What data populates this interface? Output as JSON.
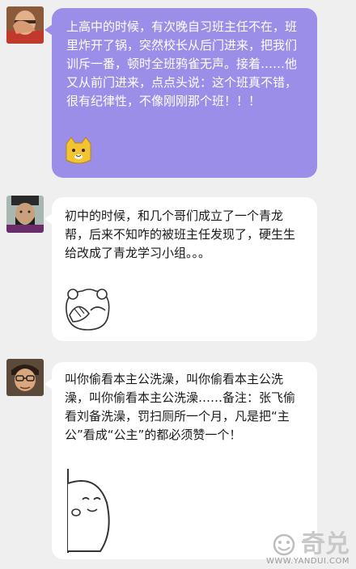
{
  "messages": [
    {
      "text": "上高中的时候，有次晚自习班主任不在，班里炸开了锅，突然校长从后门进来，把我们训斥一番，顿时全班鸦雀无声。接着……他又从前门进来，点点头说：这个班真不错，很有纪律性，不像刚刚那个班！！！",
      "sticker": "yellow-cat-emoji-icon"
    },
    {
      "text": "初中的时候，和几个哥们成立了一个青龙帮，后来不知咋的被班主任发现了，硬生生给改成了青龙学习小组。。。",
      "sticker": "bear-covering-face-sticker"
    },
    {
      "text": "叫你偷看本主公洗澡，叫你偷看本主公洗澡，叫你偷看本主公洗澡……备注：张飞偷看刘备洗澡，罚扫厕所一个月，凡是把“主公”看成“公主”的都必须赞一个！",
      "sticker": "peeking-blob-sticker"
    }
  ],
  "watermark": {
    "logo_text": "奇兑",
    "url": "WWW.YANDUI.COM"
  },
  "colors": {
    "background": "#efefef",
    "purple_bubble": "#9b8ee8",
    "white_bubble": "#ffffff"
  }
}
